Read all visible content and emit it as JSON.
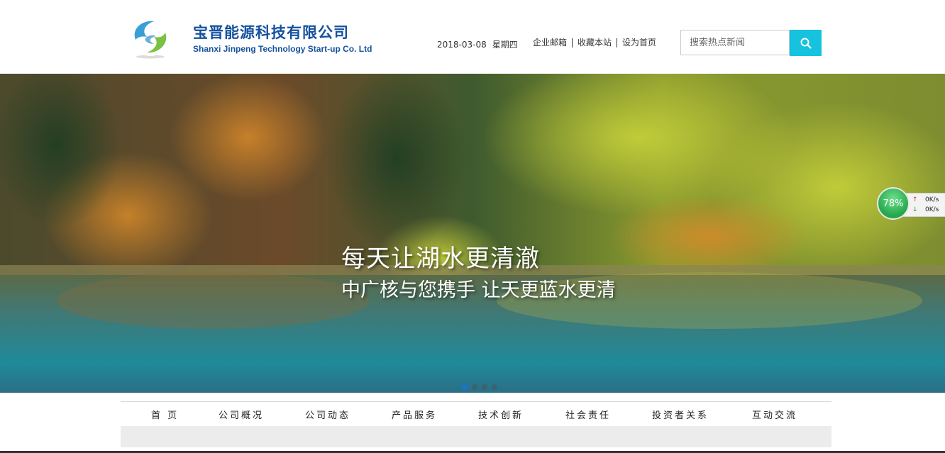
{
  "header": {
    "company_cn": "宝晋能源科技有限公司",
    "company_en": "Shanxi Jinpeng Technology Start-up Co. Ltd",
    "date": "2018-03-08",
    "weekday": "星期四",
    "links": [
      "企业邮箱",
      "收藏本站",
      "设为首页"
    ],
    "search_placeholder": "搜索热点新闻",
    "search_icon": "search-icon",
    "colors": {
      "brand": "#14519e",
      "search_button": "#16c2de"
    }
  },
  "banner": {
    "title": "每天让湖水更清澈",
    "subtitle": "中广核与您携手 让天更蓝水更清",
    "slide_count": 4,
    "active_slide": 1
  },
  "speed_widget": {
    "percent": "78%",
    "upload": "0K/s",
    "download": "0K/s"
  },
  "nav": {
    "items": [
      "首 页",
      "公司概况",
      "公司动态",
      "产品服务",
      "技术创新",
      "社会责任",
      "投资者关系",
      "互动交流"
    ]
  }
}
